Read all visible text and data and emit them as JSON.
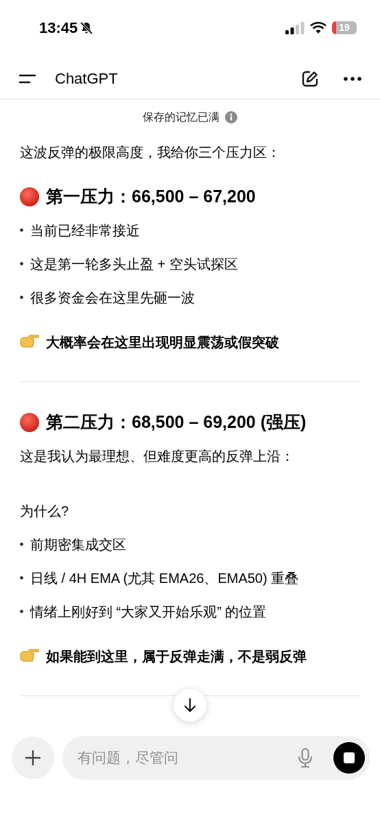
{
  "status_bar": {
    "time": "13:45",
    "battery": "19"
  },
  "header": {
    "title": "ChatGPT"
  },
  "memory_notice": "保存的记忆已满",
  "content": [
    {
      "kind": "paragraph",
      "text": "这波反弹的极限高度，我给你三个压力区："
    },
    {
      "kind": "heading",
      "text": "第一压力：66,500 – 67,200"
    },
    {
      "kind": "bullet",
      "text": "当前已经非常接近"
    },
    {
      "kind": "bullet",
      "text": "这是第一轮多头止盈 + 空头试探区"
    },
    {
      "kind": "bullet",
      "text": "很多资金会在这里先砸一波"
    },
    {
      "kind": "callout",
      "text": "大概率会在这里出现明显震荡或假突破"
    },
    {
      "kind": "divider"
    },
    {
      "kind": "heading",
      "text": "第二压力：68,500 – 69,200 (强压)"
    },
    {
      "kind": "paragraph",
      "text": "这是我认为最理想、但难度更高的反弹上沿："
    },
    {
      "kind": "paragraph",
      "text": "为什么?"
    },
    {
      "kind": "bullet",
      "text": "前期密集成交区"
    },
    {
      "kind": "bullet",
      "text": "日线 / 4H EMA (尤其 EMA26、EMA50) 重叠"
    },
    {
      "kind": "bullet",
      "text": "情绪上刚好到 “大家又开始乐观” 的位置"
    },
    {
      "kind": "callout",
      "text": "如果能到这里，属于反弹走满，不是弱反弹"
    },
    {
      "kind": "divider"
    }
  ],
  "composer": {
    "placeholder": "有问题，尽管问"
  }
}
